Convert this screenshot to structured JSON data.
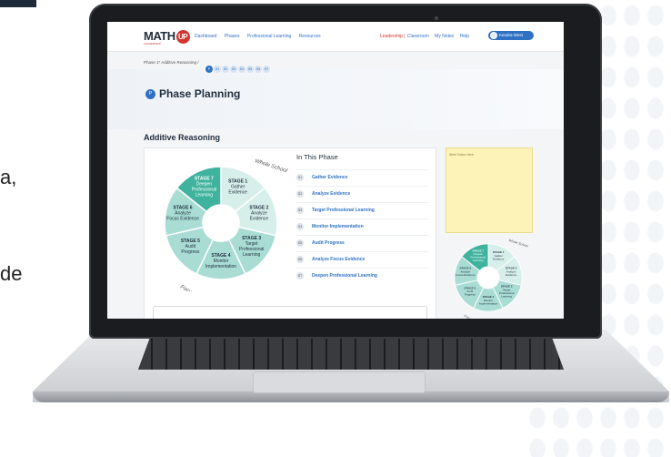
{
  "side_text": [
    "a,",
    "de"
  ],
  "app": {
    "logo": {
      "text": "MATH",
      "badge": "UP",
      "sub": "LEADERSHIP"
    },
    "nav": [
      "Dashboard",
      "Phases",
      "Professional Learning",
      "Resources"
    ],
    "nav_right": {
      "active": "Leadership",
      "separator": "|",
      "links": [
        "Classroom",
        "My Notes",
        "Help"
      ]
    },
    "user": "Kendra West"
  },
  "breadcrumb": "Phase 1* Additive Reasoning /",
  "stage_dots": [
    {
      "label": "P",
      "active": true
    },
    {
      "label": "S1",
      "active": false
    },
    {
      "label": "S2",
      "active": false
    },
    {
      "label": "S3",
      "active": false
    },
    {
      "label": "S4",
      "active": false
    },
    {
      "label": "S5",
      "active": false
    },
    {
      "label": "S6",
      "active": false
    },
    {
      "label": "S7",
      "active": false
    }
  ],
  "page": {
    "badge": "P",
    "title": "Phase Planning",
    "section": "Additive Reasoning"
  },
  "wheel": {
    "top_label": "Whole School",
    "bottom_label": "Focused",
    "segments": [
      {
        "lines": [
          "STAGE 1",
          "Gather",
          "Evidence"
        ]
      },
      {
        "lines": [
          "STAGE 2",
          "Analyze",
          "Evidence"
        ]
      },
      {
        "lines": [
          "STAGE 3",
          "Target",
          "Professional",
          "Learning"
        ]
      },
      {
        "lines": [
          "STAGE 4",
          "Monitor",
          "Implementation"
        ]
      },
      {
        "lines": [
          "STAGE 5",
          "Audit",
          "Progress"
        ]
      },
      {
        "lines": [
          "STAGE 6",
          "Analyze",
          "Focus Evidence"
        ]
      },
      {
        "lines": [
          "STAGE 7",
          "Deepen",
          "Professional",
          "Learning"
        ]
      }
    ],
    "colors": {
      "light": "#d7efeb",
      "mid": "#a9ddd4",
      "dark": "#3fb39d",
      "stroke": "#ffffff"
    }
  },
  "phase": {
    "heading": "In This Phase",
    "steps": [
      {
        "num": "S1",
        "label": "Gather Evidence"
      },
      {
        "num": "S2",
        "label": "Analyze Evidence"
      },
      {
        "num": "S3",
        "label": "Target Professional Learning"
      },
      {
        "num": "S4",
        "label": "Monitor Implementation"
      },
      {
        "num": "S5",
        "label": "Audit Progress"
      },
      {
        "num": "S6",
        "label": "Analyze Focus Evidence"
      },
      {
        "num": "S7",
        "label": "Deepen Professional Learning"
      }
    ]
  },
  "notes": {
    "placeholder": "Write Notes Here"
  },
  "colors": {
    "accent": "#2f72c4",
    "brand_red": "#d3352f",
    "notes_bg": "#fdf3b8"
  }
}
